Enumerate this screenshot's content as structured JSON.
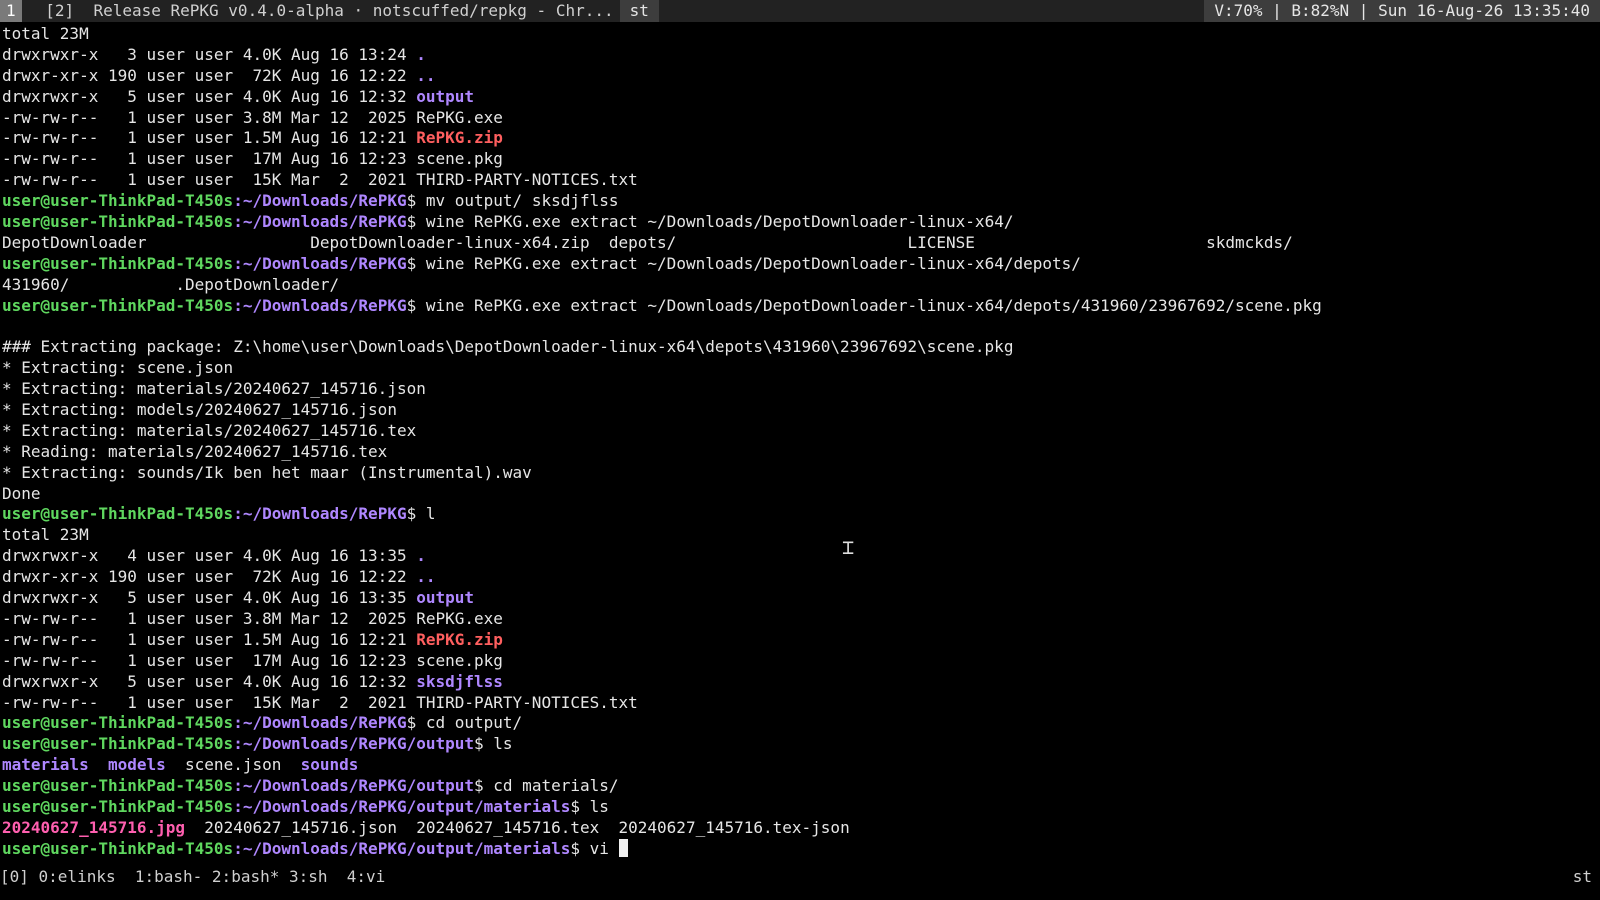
{
  "topbar": {
    "active_tag": "1",
    "window_title": " [2]  Release RePKG v0.4.0-alpha · notscuffed/repkg - Chr...",
    "terminal_name": "st",
    "status": "V:70% | B:82%N | Sun 16-Aug-26 13:35:40"
  },
  "prompt": {
    "user": "user@user-ThinkPad-T450s",
    "sep": ":"
  },
  "lines": [
    {
      "parts": [
        {
          "t": "total 23M"
        }
      ]
    },
    {
      "parts": [
        {
          "t": "drwxrwxr-x   3 user user 4.0K Aug 16 13:24 "
        },
        {
          "t": ".",
          "c": "dir"
        }
      ]
    },
    {
      "parts": [
        {
          "t": "drwxr-xr-x 190 user user  72K Aug 16 12:22 "
        },
        {
          "t": "..",
          "c": "dir"
        }
      ]
    },
    {
      "parts": [
        {
          "t": "drwxrwxr-x   5 user user 4.0K Aug 16 12:32 "
        },
        {
          "t": "output",
          "c": "dir"
        }
      ]
    },
    {
      "parts": [
        {
          "t": "-rw-rw-r--   1 user user 3.8M Mar 12  2025 RePKG.exe"
        }
      ]
    },
    {
      "parts": [
        {
          "t": "-rw-rw-r--   1 user user 1.5M Aug 16 12:21 "
        },
        {
          "t": "RePKG.zip",
          "c": "zip"
        }
      ]
    },
    {
      "parts": [
        {
          "t": "-rw-rw-r--   1 user user  17M Aug 16 12:23 scene.pkg"
        }
      ]
    },
    {
      "parts": [
        {
          "t": "-rw-rw-r--   1 user user  15K Mar  2  2021 THIRD-PARTY-NOTICES.txt"
        }
      ]
    },
    {
      "prompt": "~/Downloads/RePKG",
      "cmd": "$ mv output/ sksdjflss"
    },
    {
      "prompt": "~/Downloads/RePKG",
      "cmd": "$ wine RePKG.exe extract ~/Downloads/DepotDownloader-linux-x64/"
    },
    {
      "parts": [
        {
          "t": "DepotDownloader                 DepotDownloader-linux-x64.zip  depots/                        LICENSE                        skdmckds/"
        }
      ]
    },
    {
      "prompt": "~/Downloads/RePKG",
      "cmd": "$ wine RePKG.exe extract ~/Downloads/DepotDownloader-linux-x64/depots/"
    },
    {
      "parts": [
        {
          "t": "431960/           .DepotDownloader/"
        }
      ]
    },
    {
      "prompt": "~/Downloads/RePKG",
      "cmd": "$ wine RePKG.exe extract ~/Downloads/DepotDownloader-linux-x64/depots/431960/23967692/scene.pkg"
    },
    {
      "parts": [
        {
          "t": ""
        }
      ]
    },
    {
      "parts": [
        {
          "t": "### Extracting package: Z:\\home\\user\\Downloads\\DepotDownloader-linux-x64\\depots\\431960\\23967692\\scene.pkg"
        }
      ]
    },
    {
      "parts": [
        {
          "t": "* Extracting: scene.json"
        }
      ]
    },
    {
      "parts": [
        {
          "t": "* Extracting: materials/20240627_145716.json"
        }
      ]
    },
    {
      "parts": [
        {
          "t": "* Extracting: models/20240627_145716.json"
        }
      ]
    },
    {
      "parts": [
        {
          "t": "* Extracting: materials/20240627_145716.tex"
        }
      ]
    },
    {
      "parts": [
        {
          "t": "* Reading: materials/20240627_145716.tex"
        }
      ]
    },
    {
      "parts": [
        {
          "t": "* Extracting: sounds/Ik ben het maar (Instrumental).wav"
        }
      ]
    },
    {
      "parts": [
        {
          "t": "Done"
        }
      ]
    },
    {
      "prompt": "~/Downloads/RePKG",
      "cmd": "$ l"
    },
    {
      "parts": [
        {
          "t": "total 23M"
        }
      ]
    },
    {
      "parts": [
        {
          "t": "drwxrwxr-x   4 user user 4.0K Aug 16 13:35 "
        },
        {
          "t": ".",
          "c": "dir"
        }
      ]
    },
    {
      "parts": [
        {
          "t": "drwxr-xr-x 190 user user  72K Aug 16 12:22 "
        },
        {
          "t": "..",
          "c": "dir"
        }
      ]
    },
    {
      "parts": [
        {
          "t": "drwxrwxr-x   5 user user 4.0K Aug 16 13:35 "
        },
        {
          "t": "output",
          "c": "dir"
        }
      ]
    },
    {
      "parts": [
        {
          "t": "-rw-rw-r--   1 user user 3.8M Mar 12  2025 RePKG.exe"
        }
      ]
    },
    {
      "parts": [
        {
          "t": "-rw-rw-r--   1 user user 1.5M Aug 16 12:21 "
        },
        {
          "t": "RePKG.zip",
          "c": "zip"
        }
      ]
    },
    {
      "parts": [
        {
          "t": "-rw-rw-r--   1 user user  17M Aug 16 12:23 scene.pkg"
        }
      ]
    },
    {
      "parts": [
        {
          "t": "drwxrwxr-x   5 user user 4.0K Aug 16 12:32 "
        },
        {
          "t": "sksdjflss",
          "c": "dir"
        }
      ]
    },
    {
      "parts": [
        {
          "t": "-rw-rw-r--   1 user user  15K Mar  2  2021 THIRD-PARTY-NOTICES.txt"
        }
      ]
    },
    {
      "prompt": "~/Downloads/RePKG",
      "cmd": "$ cd output/"
    },
    {
      "prompt": "~/Downloads/RePKG/output",
      "cmd": "$ ls"
    },
    {
      "parts": [
        {
          "t": "materials",
          "c": "dir"
        },
        {
          "t": "  "
        },
        {
          "t": "models",
          "c": "dir"
        },
        {
          "t": "  scene.json  "
        },
        {
          "t": "sounds",
          "c": "dir"
        }
      ]
    },
    {
      "prompt": "~/Downloads/RePKG/output",
      "cmd": "$ cd materials/"
    },
    {
      "prompt": "~/Downloads/RePKG/output/materials",
      "cmd": "$ ls"
    },
    {
      "parts": [
        {
          "t": "20240627_145716.jpg",
          "c": "img"
        },
        {
          "t": "  20240627_145716.json  20240627_145716.tex  20240627_145716.tex-json"
        }
      ]
    },
    {
      "prompt": "~/Downloads/RePKG/output/materials",
      "cmd": "$ vi ",
      "cursor": true
    }
  ],
  "statusline": {
    "windows": "[0] 0:elinks  1:bash- 2:bash* 3:sh  4:vi",
    "right": "st"
  },
  "colors": {
    "prompt_user": "#5fd75f",
    "prompt_path": "#af87ff",
    "directory": "#af87ff",
    "archive": "#ff5f5f",
    "image": "#ff5faf",
    "background": "#000000"
  }
}
